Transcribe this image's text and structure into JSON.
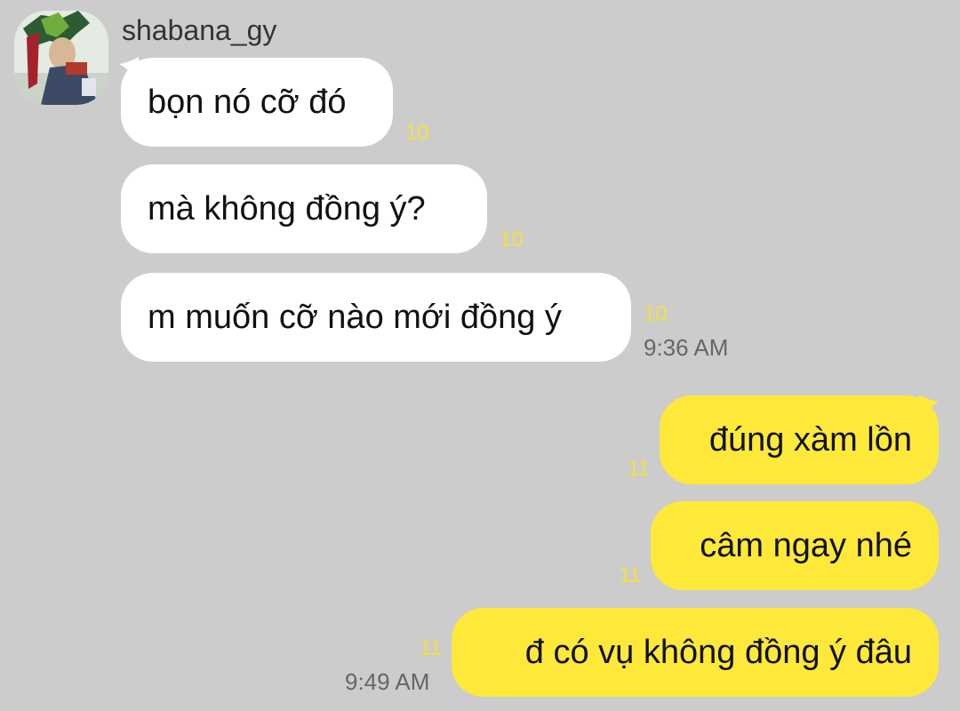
{
  "conversation": {
    "sender_name": "shabana_gy",
    "incoming": [
      {
        "text": "bọn nó cỡ đó",
        "unread": "10"
      },
      {
        "text": "mà không đồng ý?",
        "unread": "10"
      },
      {
        "text": "m muốn cỡ nào mới đồng ý",
        "unread": "10",
        "time": "9:36 AM"
      }
    ],
    "outgoing": [
      {
        "text": "đúng xàm lồn",
        "unread": "11"
      },
      {
        "text": "câm ngay nhé",
        "unread": "11"
      },
      {
        "text": "đ có vụ không đồng ý đâu",
        "unread": "11",
        "time": "9:49 AM"
      }
    ]
  },
  "colors": {
    "background": "#cccccc",
    "incoming_bubble": "#ffffff",
    "outgoing_bubble": "#fee93b",
    "unread_count": "#f5e13a",
    "timestamp": "#666666"
  },
  "icons": {
    "avatar": "profile-avatar"
  }
}
